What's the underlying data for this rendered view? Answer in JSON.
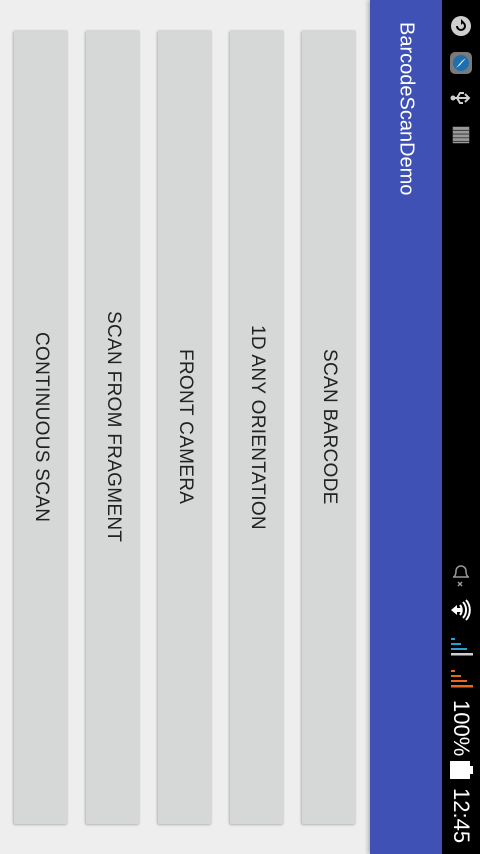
{
  "app": {
    "title": "BarcodeScanDemo"
  },
  "status_bar": {
    "battery_percent": "100%",
    "time": "12:45",
    "icons": [
      "refresh-icon",
      "compass-icon",
      "usb-icon",
      "storage-icon",
      "alarm-off-icon",
      "wifi-icon",
      "signal-icon",
      "data-signal-icon",
      "battery-icon"
    ]
  },
  "buttons": [
    {
      "label": "SCAN BARCODE"
    },
    {
      "label": "1D ANY ORIENTATION"
    },
    {
      "label": "FRONT CAMERA"
    },
    {
      "label": "SCAN FROM FRAGMENT"
    },
    {
      "label": "CONTINUOUS SCAN"
    }
  ],
  "colors": {
    "primary": "#3f51b5",
    "background": "#eeeeee",
    "button": "#d6d7d7",
    "status_bar": "#000000"
  }
}
